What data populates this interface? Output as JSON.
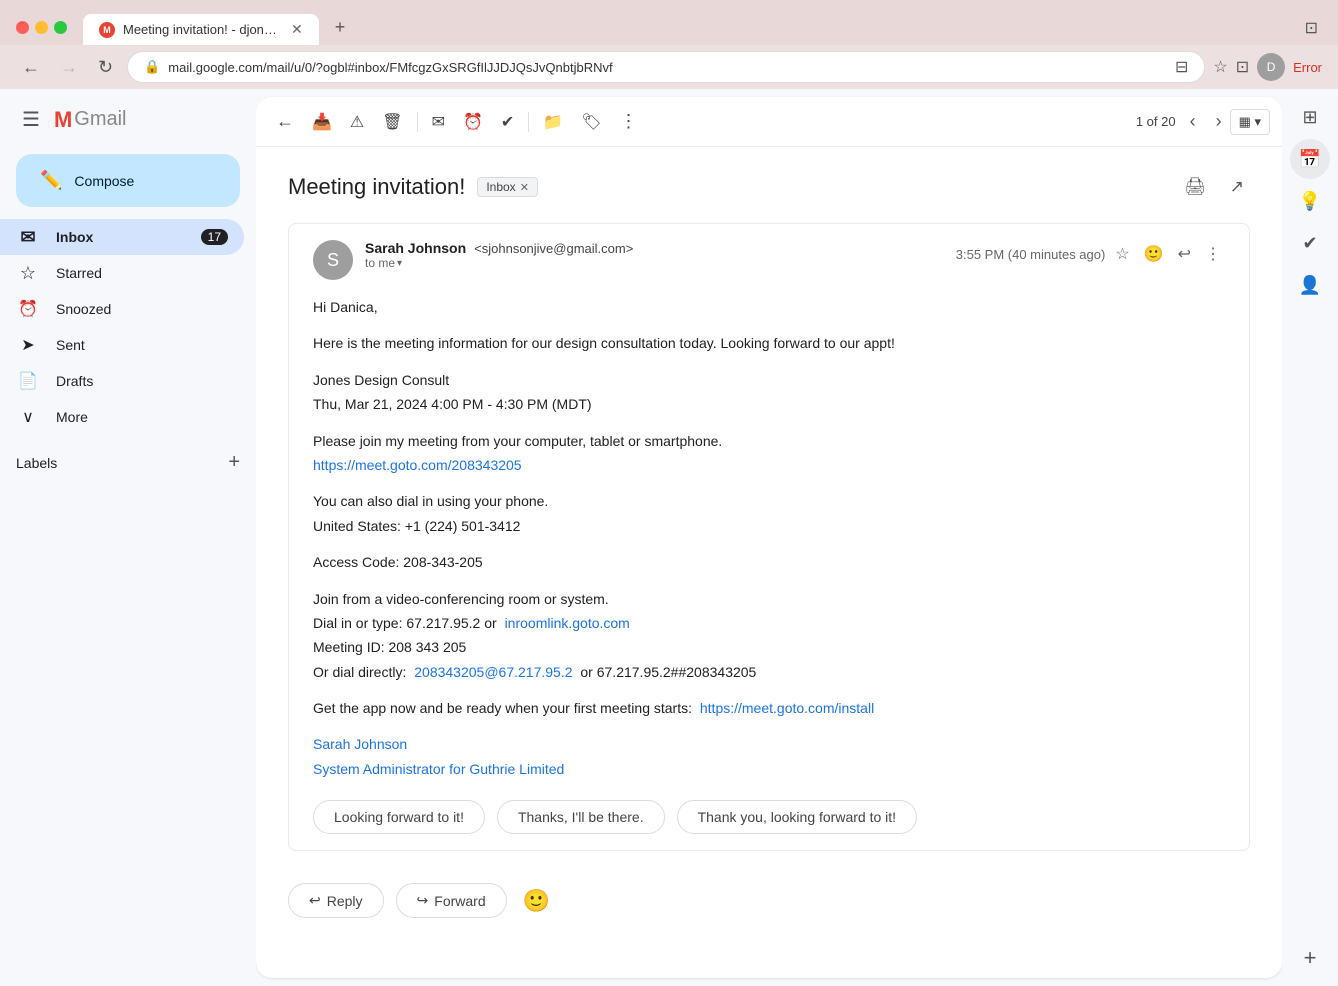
{
  "browser": {
    "tab_title": "Meeting invitation! - djones.g...",
    "tab_favicon": "M",
    "url": "mail.google.com/mail/u/0/?ogbl#inbox/FMfcgzGxSRGfIlJJDJQsJvQnbtjbRNvf",
    "new_tab_label": "+",
    "nav": {
      "back_label": "←",
      "forward_label": "→",
      "refresh_label": "↻"
    },
    "toolbar": {
      "error_label": "Error"
    }
  },
  "sidebar": {
    "hamburger_label": "☰",
    "logo_m": "M",
    "logo_text": "Gmail",
    "compose_label": "Compose",
    "nav_items": [
      {
        "id": "inbox",
        "label": "Inbox",
        "icon": "✉",
        "badge": "17",
        "active": true
      },
      {
        "id": "starred",
        "label": "Starred",
        "icon": "☆",
        "badge": null,
        "active": false
      },
      {
        "id": "snoozed",
        "label": "Snoozed",
        "icon": "🕐",
        "badge": null,
        "active": false
      },
      {
        "id": "sent",
        "label": "Sent",
        "icon": "➤",
        "badge": null,
        "active": false
      },
      {
        "id": "drafts",
        "label": "Drafts",
        "icon": "📄",
        "badge": null,
        "active": false
      },
      {
        "id": "more",
        "label": "More",
        "icon": "∨",
        "badge": null,
        "active": false
      }
    ],
    "labels_heading": "Labels",
    "add_label_icon": "+"
  },
  "toolbar": {
    "back_icon": "←",
    "archive_icon": "📥",
    "spam_icon": "⚠",
    "delete_icon": "🗑",
    "mark_unread_icon": "✉",
    "snooze_icon": "🕐",
    "task_icon": "✓",
    "move_icon": "📁",
    "label_icon": "🏷",
    "more_icon": "⋮",
    "pagination_text": "1 of 20",
    "prev_icon": "‹",
    "next_icon": "›",
    "view_icon": "▦"
  },
  "email": {
    "subject": "Meeting invitation!",
    "inbox_tag_label": "Inbox",
    "sender_name": "Sarah Johnson",
    "sender_email": "sjohnsonjive@gmail.com",
    "to_me_label": "to me",
    "time": "3:55 PM (40 minutes ago)",
    "avatar_letter": "S",
    "body": {
      "greeting": "Hi Danica,",
      "intro": "Here is the meeting information for our design consultation today. Looking forward to our appt!",
      "event_name": "Jones Design Consult",
      "event_time": "Thu, Mar 21, 2024 4:00 PM - 4:30 PM (MDT)",
      "join_text": "Please join my meeting from your computer, tablet or smartphone.",
      "join_link": "https://meet.goto.com/208343205",
      "dialin_text": "You can also dial in using your phone.",
      "us_number": "United States: +1 (224) 501-3412",
      "access_code": "Access Code: 208-343-205",
      "video_conf_text": "Join from a video-conferencing room or system.",
      "dial_type_text": "Dial in or type: 67.217.95.2 or",
      "inroom_link": "inroomlink.goto.com",
      "meeting_id": "Meeting ID: 208 343 205",
      "dial_directly": "Or dial directly:",
      "dial_link1": "208343205@67.217.95.2",
      "dial_or": "or 67.217.95.2##208343205",
      "get_app_text": "Get the app now and be ready when your first meeting starts:",
      "install_link": "https://meet.goto.com/install",
      "sig_name": "Sarah Johnson",
      "sig_title": "System Administrator for Guthrie Limited"
    },
    "quick_replies": [
      {
        "id": "qr1",
        "label": "Looking forward to it!"
      },
      {
        "id": "qr2",
        "label": "Thanks, I'll be there."
      },
      {
        "id": "qr3",
        "label": "Thank you, looking forward to it!"
      }
    ],
    "actions": {
      "reply_label": "Reply",
      "forward_label": "Forward",
      "reply_icon": "↩",
      "forward_icon": "↪"
    }
  },
  "right_panel": {
    "icons": [
      {
        "id": "google-apps",
        "symbol": "⊞",
        "active": false
      },
      {
        "id": "calendar",
        "symbol": "📅",
        "active": false
      },
      {
        "id": "keep",
        "symbol": "💡",
        "active": false
      },
      {
        "id": "tasks",
        "symbol": "✓",
        "active": false
      },
      {
        "id": "contacts",
        "symbol": "👤",
        "active": false
      },
      {
        "id": "add",
        "symbol": "+",
        "active": false
      }
    ]
  }
}
